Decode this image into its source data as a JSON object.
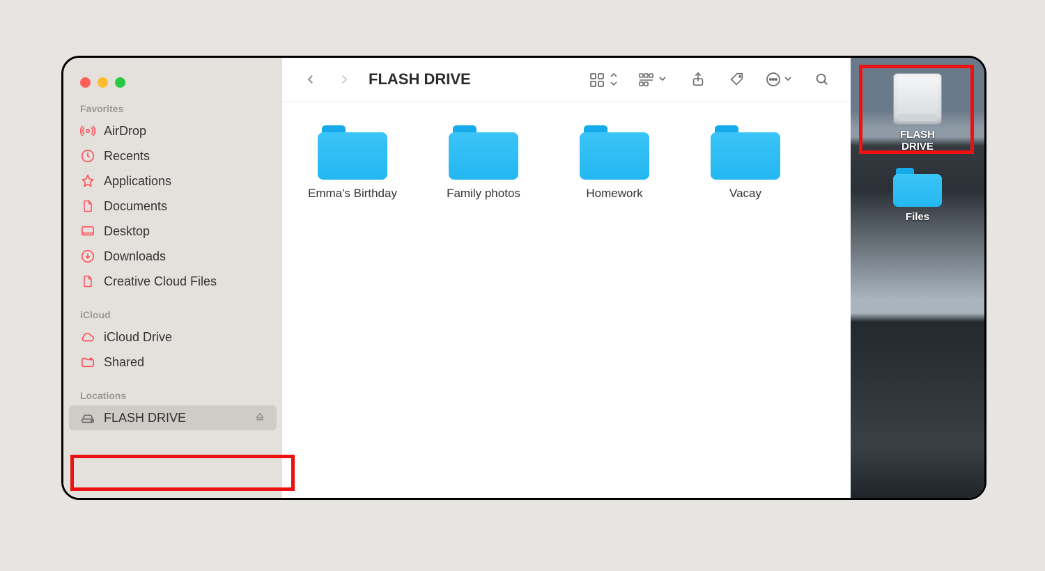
{
  "finder": {
    "title": "FLASH DRIVE",
    "sections": {
      "favorites_head": "Favorites",
      "icloud_head": "iCloud",
      "locations_head": "Locations"
    },
    "favorites": [
      {
        "label": "AirDrop"
      },
      {
        "label": "Recents"
      },
      {
        "label": "Applications"
      },
      {
        "label": "Documents"
      },
      {
        "label": "Desktop"
      },
      {
        "label": "Downloads"
      },
      {
        "label": "Creative Cloud Files"
      }
    ],
    "icloud": [
      {
        "label": "iCloud Drive"
      },
      {
        "label": "Shared"
      }
    ],
    "locations": [
      {
        "label": "FLASH DRIVE"
      }
    ],
    "folders": [
      {
        "name": "Emma's Birthday"
      },
      {
        "name": "Family photos"
      },
      {
        "name": "Homework"
      },
      {
        "name": "Vacay"
      }
    ]
  },
  "desktop": {
    "drive_label": "FLASH DRIVE",
    "folder_label": "Files"
  }
}
